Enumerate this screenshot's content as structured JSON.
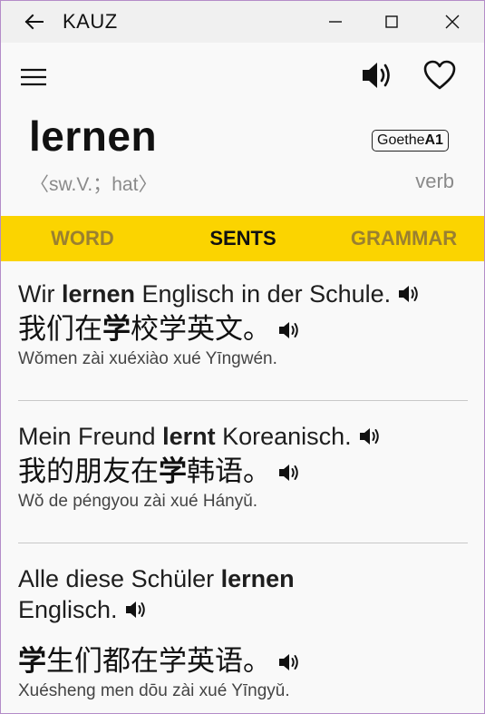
{
  "window": {
    "title": "KAUZ"
  },
  "entry": {
    "word": "lernen",
    "badge_prefix": "Goethe",
    "badge_level": "A1",
    "grammar": "〈sw.V.；hat〉",
    "part_of_speech": "verb"
  },
  "tabs": [
    {
      "label": "WORD",
      "active": false
    },
    {
      "label": "SENTS",
      "active": true
    },
    {
      "label": "GRAMMAR",
      "active": false
    }
  ],
  "sentences": [
    {
      "de_pre": "Wir ",
      "de_bold": "lernen",
      "de_post": " Englisch in der Schule.",
      "zh_pre": "我们在",
      "zh_bold": "学",
      "zh_post": "校学英文。",
      "pinyin": "Wǒmen zài xuéxiào xué Yīngwén."
    },
    {
      "de_pre": "Mein Freund ",
      "de_bold": "lernt",
      "de_post": " Koreanisch.",
      "zh_pre": "我的朋友在",
      "zh_bold": "学",
      "zh_post": "韩语。",
      "pinyin": "Wǒ de péngyou zài xué Hányǔ."
    },
    {
      "de_pre": "Alle diese Schüler ",
      "de_bold": "lernen",
      "de_post": " Englisch.",
      "zh_pre": "",
      "zh_bold": "学",
      "zh_post": "生们都在学英语。",
      "pinyin": "Xuésheng men dōu zài xué Yīngyǔ."
    }
  ],
  "colors": {
    "tab_bar": "#fbd400",
    "tab_inactive": "#9a8030",
    "muted_text": "#8a8a8a"
  }
}
